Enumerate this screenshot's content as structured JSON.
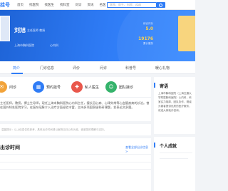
{
  "header": {
    "logo": "挂号",
    "nav": [
      "首页",
      "找医院",
      "找医生",
      "找科室",
      "问诊",
      "资讯",
      "名医"
    ],
    "search_placeholder": "医院、医生、科室、疾病"
  },
  "doctor": {
    "name": "刘旭",
    "title": "主任医师  教授",
    "hospital": "上海市胸科医院",
    "department": "心内科",
    "stat1_value": "5.0",
    "stat1_label": "综合评分",
    "stat2_value": "19176",
    "stat2_label": "累计服务"
  },
  "tabs": [
    "简介",
    "门诊信息",
    "评价",
    "问诊",
    "科普号",
    "暖心礼物"
  ],
  "actions": [
    {
      "label": "问诊",
      "color": "#f2a33a",
      "icon": "chat-icon"
    },
    {
      "label": "预约挂号",
      "color": "#2f7cf6",
      "icon": "calendar-icon"
    },
    {
      "label": "私人医生",
      "color": "#e9574b",
      "icon": "doctor-icon"
    },
    {
      "label": "团队接诊",
      "color": "#35b36b",
      "icon": "team-icon"
    }
  ],
  "bio": "主任医师，教授，博士生导师，现任上海市胸科医院心内科主任，擅长冠心病、心律失常等心血管疾病的诊治。曾在国外知名医院学习，在复杂冠脉介入治疗方面经验丰富，主持多项国家级科研课题，发表论文多篇。",
  "notice": "温馨提示：以上信息仅供参考，具体出诊时间请以医院当日公布为准，谢谢您的理解与支持。",
  "schedule": {
    "title": "出诊时间",
    "link": "查看全部出诊信息 >"
  },
  "side": {
    "sign_title": "寄语",
    "sign_text": "上海市胸科医院（上海交通大学附属胸科医院）心内科，科室实力雄厚，团队协作，竭诚为患者提供优质的医疗服务，欢迎大家就诊咨询。",
    "honor_title": "个人成就"
  }
}
